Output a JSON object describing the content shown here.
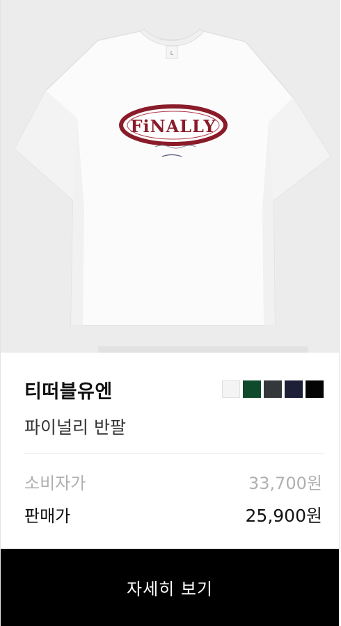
{
  "product": {
    "image_alt": "white t-shirt with red FINALLY oval logo",
    "logo_text": "FiNALLY",
    "brand": "티떠블유엔",
    "name": "파이널리 반팔"
  },
  "swatches": [
    {
      "name": "white",
      "color": "#f4f4f4"
    },
    {
      "name": "green",
      "color": "#0f4a2c"
    },
    {
      "name": "charcoal",
      "color": "#35383b"
    },
    {
      "name": "navy",
      "color": "#1c1f35"
    },
    {
      "name": "black",
      "color": "#050505"
    }
  ],
  "prices": {
    "consumer_label": "소비자가",
    "consumer_value": "33,700원",
    "sale_label": "판매가",
    "sale_value": "25,900원"
  },
  "cta": {
    "label": "자세히 보기"
  }
}
